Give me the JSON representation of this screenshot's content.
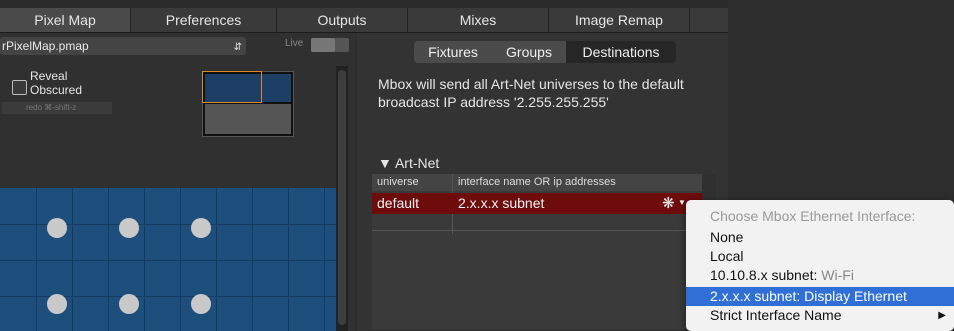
{
  "tabs": [
    {
      "label": "Pixel Map",
      "active": true
    },
    {
      "label": "Preferences",
      "active": false
    },
    {
      "label": "Outputs",
      "active": false
    },
    {
      "label": "Mixes",
      "active": false
    },
    {
      "label": "Image Remap",
      "active": false
    }
  ],
  "left": {
    "file_name": "rPixelMap.pmap",
    "live_label": "Live",
    "reveal_label": "Reveal",
    "obscured_label": "Obscured",
    "redo_hint": "redo ⌘-shift-z"
  },
  "subtabs": [
    {
      "label": "Fixtures",
      "active": false
    },
    {
      "label": "Groups",
      "active": false
    },
    {
      "label": "Destinations",
      "active": true
    }
  ],
  "info": {
    "line1": "Mbox will send all Art-Net universes to the default",
    "line2": "broadcast IP address  '2.255.255.255'"
  },
  "artnet": {
    "section_label": "▼ Art-Net",
    "columns": [
      "universe",
      "interface name OR ip addresses"
    ],
    "rows": [
      {
        "universe": "default",
        "interface": "2.x.x.x subnet"
      }
    ]
  },
  "menu": {
    "header": "Choose Mbox Ethernet Interface:",
    "items": [
      {
        "label": "None",
        "suffix": "",
        "selected": false
      },
      {
        "label": "Local",
        "suffix": "",
        "selected": false
      },
      {
        "label": "10.10.8.x subnet:",
        "suffix": " Wi-Fi",
        "selected": false
      },
      {
        "label": "2.x.x.x subnet:",
        "suffix": " Display Ethernet",
        "selected": true
      },
      {
        "label": "Strict Interface Name",
        "suffix": "",
        "selected": false,
        "submenu": true
      }
    ]
  },
  "colors": {
    "selected_row": "#6e0c0c",
    "menu_highlight": "#2f6fd6",
    "pixel_grid": "#1e4f7c"
  },
  "icons": [
    "stepper-icon",
    "gear-icon",
    "submenu-arrow-icon",
    "disclosure-triangle-icon"
  ]
}
